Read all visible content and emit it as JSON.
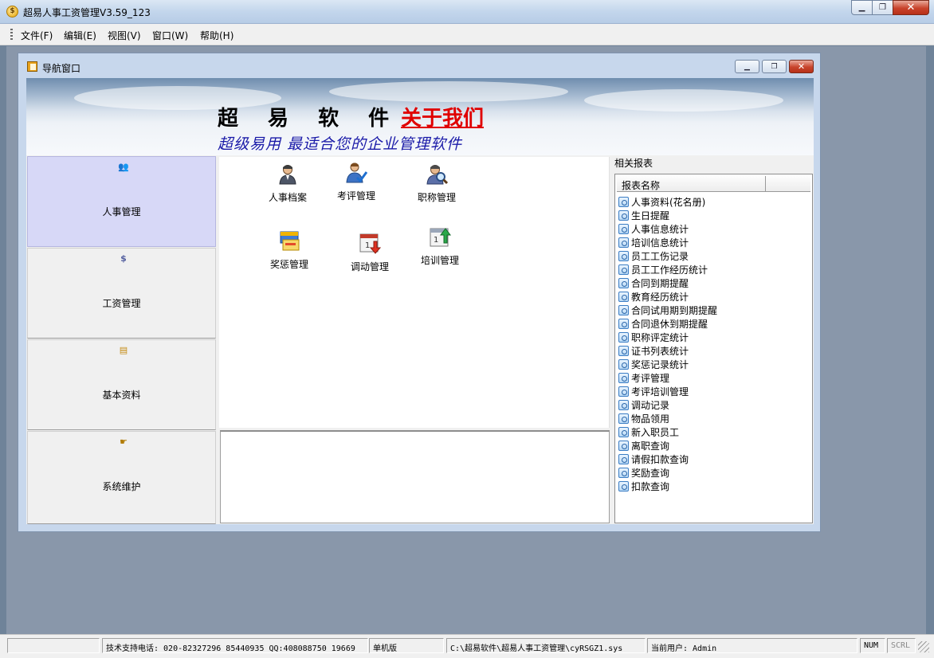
{
  "window": {
    "title": "超易人事工资管理V3.59_123"
  },
  "menu": [
    "文件(F)",
    "编辑(E)",
    "视图(V)",
    "窗口(W)",
    "帮助(H)"
  ],
  "child_window": {
    "title": "导航窗口"
  },
  "banner": {
    "brand": "超 易 软 件",
    "about_link": "关于我们",
    "slogan": "超级易用 最适合您的企业管理软件"
  },
  "nav": [
    {
      "label": "人事管理",
      "icon": "people-icon",
      "glyph": "👥",
      "active": true
    },
    {
      "label": "工资管理",
      "icon": "money-icon",
      "glyph": "$",
      "active": false
    },
    {
      "label": "基本资料",
      "icon": "folder-icon",
      "glyph": "▤",
      "active": false
    },
    {
      "label": "系统维护",
      "icon": "hand-pointer-icon",
      "glyph": "☛",
      "active": false
    }
  ],
  "modules": [
    {
      "label": "人事档案",
      "icon": "person-icon"
    },
    {
      "label": "考评管理",
      "icon": "person-check-icon"
    },
    {
      "label": "职称管理",
      "icon": "person-search-icon"
    },
    {
      "label": "奖惩管理",
      "icon": "award-card-icon"
    },
    {
      "label": "调动管理",
      "icon": "calendar-down-icon"
    },
    {
      "label": "培训管理",
      "icon": "calendar-up-icon"
    }
  ],
  "reports": {
    "title": "相关报表",
    "column_header": "报表名称",
    "items": [
      "人事资料(花名册)",
      "生日提醒",
      "人事信息统计",
      "培训信息统计",
      "员工工伤记录",
      "员工工作经历统计",
      "合同到期提醒",
      "教育经历统计",
      "合同试用期到期提醒",
      "合同退休到期提醒",
      "职称评定统计",
      "证书列表统计",
      "奖惩记录统计",
      "考评管理",
      "考评培训管理",
      "调动记录",
      "物品领用",
      "新入职员工",
      "离职查询",
      "请假扣款查询",
      "奖励查询",
      "扣款查询"
    ]
  },
  "statusbar": {
    "support": "技术支持电话: 020-82327296 85440935 QQ:408088750 19669",
    "mode": "单机版",
    "path": "C:\\超易软件\\超易人事工资管理\\cyRSGZ1.sys",
    "user": "当前用户: Admin",
    "num": "NUM",
    "scrl": "SCRL"
  },
  "colors": {
    "about_link": "#e00000",
    "slogan": "#1a1aa8",
    "nav_active": "#d7d8f7"
  }
}
